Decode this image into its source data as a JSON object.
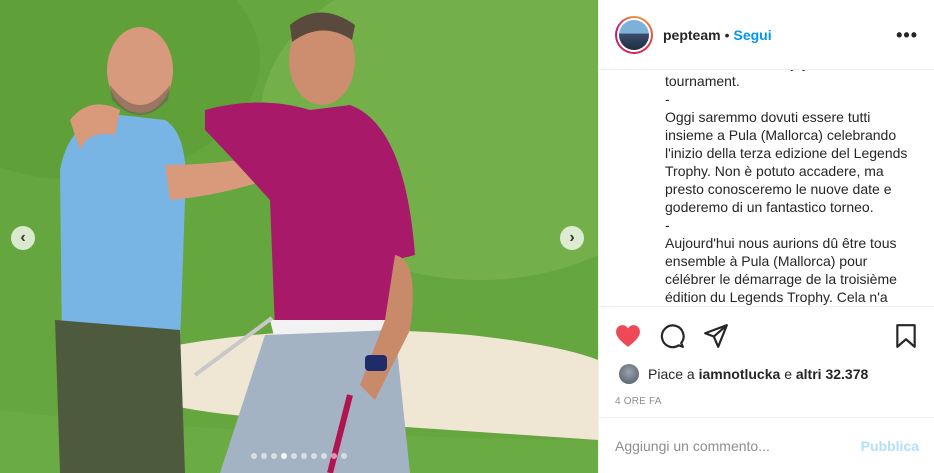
{
  "post": {
    "username": "pepteam",
    "separator": "•",
    "follow_label": "Segui",
    "more_label": "•••",
    "caption_lines": [
      "dates and we will enjoy a fantastic",
      "tournament.",
      "-",
      "Oggi saremmo dovuti essere tutti",
      "insieme a Pula (Mallorca) celebrando",
      "l'inizio della terza edizione del Legends",
      "Trophy. Non è potuto accadere, ma",
      "presto conosceremo le nuove date e",
      "goderemo di un fantastico torneo.",
      "-",
      "Aujourd'hui nous aurions dû être tous",
      "ensemble à Pula (Mallorca) pour",
      "célébrer le démarrage de la troisième",
      "édition du Legends Trophy. Cela n'a"
    ],
    "likes": {
      "prefix": "Piace a",
      "user": "iamnotlucka",
      "conj": "e",
      "others": "altri 32.378"
    },
    "time_ago": "4 ORE FA",
    "comment_placeholder": "Aggiungi un commento...",
    "publish_label": "Pubblica"
  },
  "carousel": {
    "prev_label": "‹",
    "next_label": "›",
    "slides_total": 10,
    "active_index": 3
  },
  "colors": {
    "accent": "#0095f6",
    "like": "#ed4956",
    "muted": "#8e8e8e",
    "publish_disabled": "#b2dffc"
  }
}
